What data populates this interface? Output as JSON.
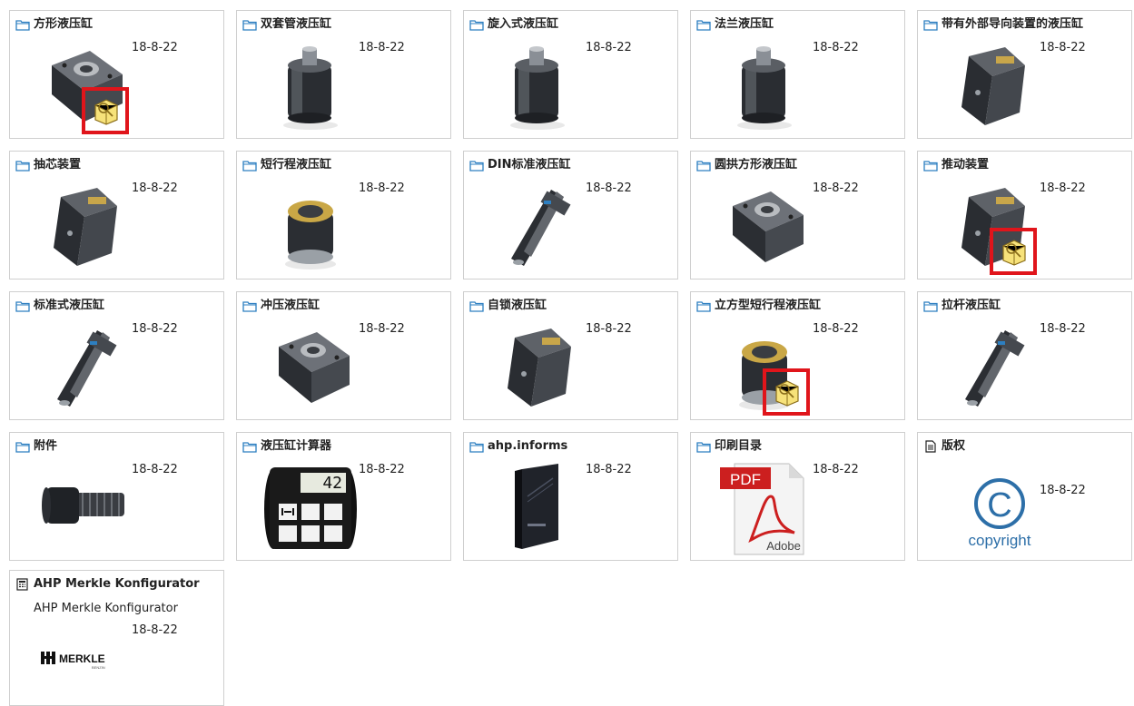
{
  "tiles": [
    {
      "title": "方形液压缸",
      "date": "18-8-22",
      "icon": "folder-icon",
      "thumb": "square-cylinder",
      "badge": true
    },
    {
      "title": "双套管液压缸",
      "date": "18-8-22",
      "icon": "folder-icon",
      "thumb": "tube-cylinder",
      "badge": false
    },
    {
      "title": "旋入式液压缸",
      "date": "18-8-22",
      "icon": "folder-icon",
      "thumb": "screw-cylinder",
      "badge": false
    },
    {
      "title": "法兰液压缸",
      "date": "18-8-22",
      "icon": "folder-icon",
      "thumb": "flange-cylinder",
      "badge": false
    },
    {
      "title": "带有外部导向装置的液压缸",
      "date": "18-8-22",
      "icon": "folder-icon",
      "thumb": "guided-cylinder",
      "badge": false
    },
    {
      "title": "抽芯装置",
      "date": "18-8-22",
      "icon": "folder-icon",
      "thumb": "core-pull",
      "badge": false
    },
    {
      "title": "短行程液压缸",
      "date": "18-8-22",
      "icon": "folder-icon",
      "thumb": "short-stroke",
      "badge": false
    },
    {
      "title": "DIN标准液压缸",
      "date": "18-8-22",
      "icon": "folder-icon",
      "thumb": "din-cylinder",
      "badge": false
    },
    {
      "title": "圆拱方形液压缸",
      "date": "18-8-22",
      "icon": "folder-icon",
      "thumb": "dome-cylinder",
      "badge": false
    },
    {
      "title": "推动装置",
      "date": "18-8-22",
      "icon": "folder-icon",
      "thumb": "push-device",
      "badge": true
    },
    {
      "title": "标准式液压缸",
      "date": "18-8-22",
      "icon": "folder-icon",
      "thumb": "standard-cylinder",
      "badge": false
    },
    {
      "title": "冲压液压缸",
      "date": "18-8-22",
      "icon": "folder-icon",
      "thumb": "press-cylinder",
      "badge": false
    },
    {
      "title": "自锁液压缸",
      "date": "18-8-22",
      "icon": "folder-icon",
      "thumb": "lock-cylinder",
      "badge": false
    },
    {
      "title": "立方型短行程液压缸",
      "date": "18-8-22",
      "icon": "folder-icon",
      "thumb": "cube-short",
      "badge": true
    },
    {
      "title": "拉杆液压缸",
      "date": "18-8-22",
      "icon": "folder-icon",
      "thumb": "tie-rod",
      "badge": false
    },
    {
      "title": "附件",
      "date": "18-8-22",
      "icon": "folder-icon",
      "thumb": "accessory",
      "badge": false
    },
    {
      "title": "液压缸计算器",
      "date": "18-8-22",
      "icon": "folder-icon",
      "thumb": "calculator",
      "badge": false,
      "calc_value": "42"
    },
    {
      "title": "ahp.informs",
      "date": "18-8-22",
      "icon": "folder-icon",
      "thumb": "book",
      "badge": false
    },
    {
      "title": "印刷目录",
      "date": "18-8-22",
      "icon": "folder-icon",
      "thumb": "pdf",
      "badge": false,
      "pdf_label": "PDF",
      "pdf_brand": "Adobe"
    },
    {
      "title": "版权",
      "date": "18-8-22",
      "icon": "document-icon",
      "thumb": "copyright",
      "badge": false,
      "copyright_label": "copyright"
    }
  ],
  "konfigurator": {
    "title": "AHP Merkle Konfigurator",
    "subtitle": "AHP Merkle Konfigurator",
    "date": "18-8-22",
    "icon": "calculator-app-icon",
    "logo_text": "MERKLE",
    "logo_sub": "BENZIN"
  },
  "colors": {
    "border": "#cfcfcf",
    "badge_border": "#e0151b",
    "folder": "#2d7fc1",
    "badge_fill": "#f7e27a"
  }
}
